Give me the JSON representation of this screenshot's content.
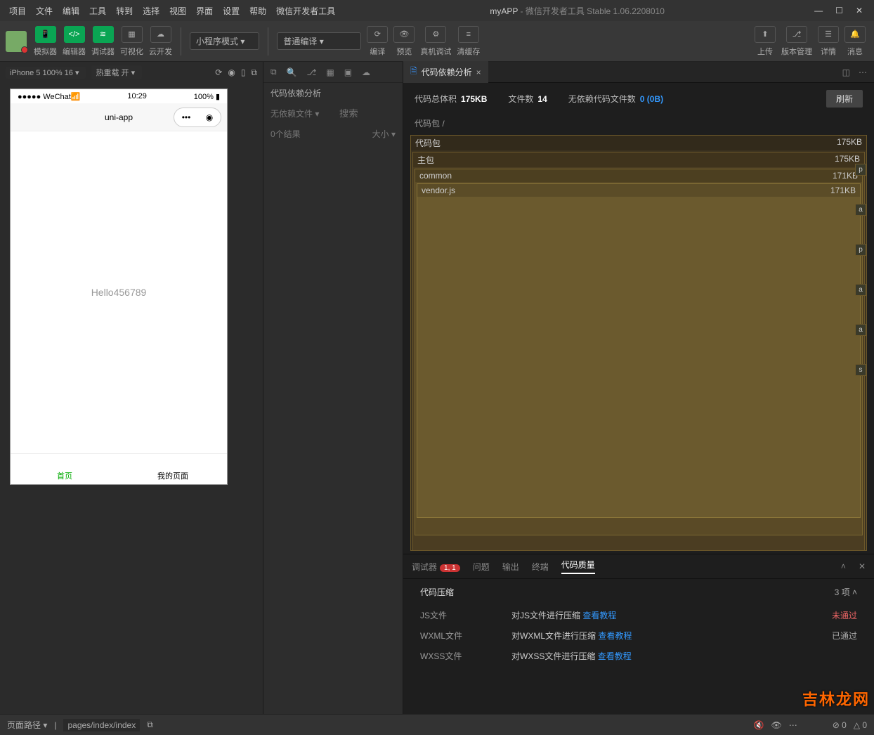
{
  "menu": [
    "项目",
    "文件",
    "编辑",
    "工具",
    "转到",
    "选择",
    "视图",
    "界面",
    "设置",
    "帮助",
    "微信开发者工具"
  ],
  "title": {
    "app": "myAPP",
    "rest": " - 微信开发者工具 Stable 1.06.2208010"
  },
  "toolbar": {
    "cols": [
      "模拟器",
      "编辑器",
      "调试器",
      "可视化",
      "云开发"
    ],
    "mode": "小程序模式",
    "compile": "普通编译",
    "actions": [
      "编译",
      "预览",
      "真机调试",
      "清缓存"
    ],
    "right": [
      "上传",
      "版本管理",
      "详情",
      "消息"
    ]
  },
  "sim": {
    "device": "iPhone 5 100% 16 ▾",
    "reload": "热重载 开 ▾",
    "status_left": "●●●●● WeChat",
    "status_time": "10:29",
    "status_batt": "100%",
    "nav_title": "uni-app",
    "body_text": "Hello456789",
    "tabs": [
      "首页",
      "我的页面"
    ]
  },
  "mid": {
    "title": "代码依赖分析",
    "filter": "无依赖文件 ▾",
    "search_ph": "搜索",
    "count": "0个结果",
    "size": "大小 ▾"
  },
  "tab": {
    "name": "代码依赖分析"
  },
  "metrics": {
    "total_lbl": "代码总体积",
    "total_val": "175KB",
    "files_lbl": "文件数",
    "files_val": "14",
    "nodep_lbl": "无依赖代码文件数",
    "nodep_val": "0 (0B)",
    "refresh": "刷新"
  },
  "crumb": "代码包 /",
  "tree": {
    "root": {
      "name": "代码包",
      "size": "175KB"
    },
    "main": {
      "name": "主包",
      "size": "175KB"
    },
    "common": {
      "name": "common",
      "size": "171KB"
    },
    "vendor": {
      "name": "vendor.js",
      "size": "171KB"
    },
    "side": [
      "p",
      "a",
      "p",
      "a",
      "a",
      "s"
    ]
  },
  "console": {
    "tabs": [
      "调试器",
      "问题",
      "输出",
      "终端",
      "代码质量"
    ],
    "badge": "1, 1",
    "section": "代码压缩",
    "section_count": "3 项",
    "rows": [
      {
        "c1": "JS文件",
        "c2": "对JS文件进行压缩 ",
        "link": "查看教程",
        "status": "未通过",
        "cls": "fail"
      },
      {
        "c1": "WXML文件",
        "c2": "对WXML文件进行压缩 ",
        "link": "查看教程",
        "status": "已通过",
        "cls": "pass"
      },
      {
        "c1": "WXSS文件",
        "c2": "对WXSS文件进行压缩 ",
        "link": "查看教程",
        "status": "",
        "cls": "pass"
      }
    ]
  },
  "status": {
    "label": "页面路径 ▾",
    "path": "pages/index/index",
    "err": "⊘ 0",
    "warn": "△ 0"
  },
  "watermark": "吉林龙网"
}
